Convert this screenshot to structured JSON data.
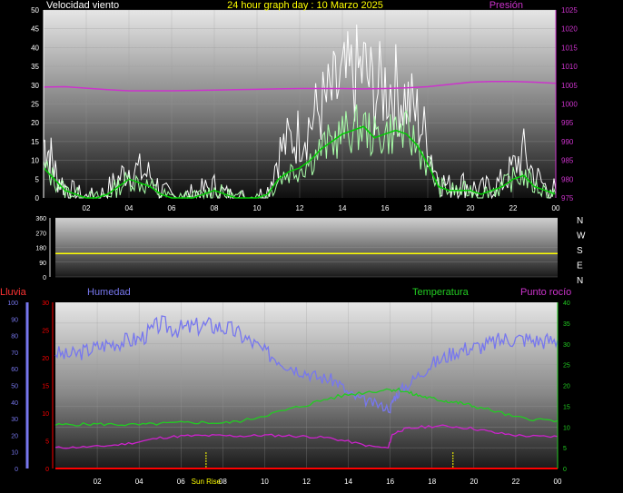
{
  "title": "24 hour graph day : 10 Marzo 2025",
  "colors": {
    "background": "#000000",
    "wind": "#ffffff",
    "gust": "#e8e8e8",
    "wind_avg": "#00cc00",
    "wind_light": "#aaffaa",
    "pressure": "#cc33cc",
    "direction": "#ffff00",
    "humidity": "#7777ee",
    "temperature": "#22cc22",
    "dewpoint": "#cc22cc",
    "rain": "#ff0000",
    "sun": "#ffff00",
    "axis_text": "#ffffff"
  },
  "x_tick_labels": [
    "02",
    "04",
    "06",
    "08",
    "10",
    "12",
    "14",
    "16",
    "18",
    "20",
    "22",
    "00"
  ],
  "chart_data": [
    {
      "type": "line",
      "name": "wind-pressure",
      "title": "",
      "left_label": "Velocidad viento",
      "right_label": "Presión",
      "ylim_left": [
        0,
        50
      ],
      "ylim_right": [
        975,
        1025
      ],
      "left_ticks": [
        "0",
        "5",
        "10",
        "15",
        "20",
        "25",
        "30",
        "35",
        "40",
        "45",
        "50"
      ],
      "right_ticks": [
        "975",
        "980",
        "985",
        "990",
        "995",
        "1000",
        "1005",
        "1010",
        "1015",
        "1020",
        "1025"
      ],
      "xlim": [
        0,
        24
      ],
      "series": [
        {
          "axis": "left",
          "x": [
            0,
            0.3,
            0.6,
            1,
            1.5,
            2,
            2.5,
            3,
            3.5,
            4,
            4.5,
            5,
            5.5,
            6,
            6.5,
            7,
            7.5,
            8,
            8.5,
            9,
            9.5,
            10,
            10.5,
            11,
            11.5,
            12,
            12.5,
            13,
            13.5,
            14,
            14.5,
            15,
            15.5,
            16,
            16.5,
            17,
            17.5,
            18,
            18.5,
            19,
            19.5,
            20,
            20.5,
            21,
            21.5,
            22,
            22.5,
            23,
            23.5,
            24
          ],
          "values": [
            15,
            12,
            6,
            3,
            1,
            0,
            0,
            2,
            5,
            8,
            7,
            6,
            2,
            0,
            0,
            1,
            2,
            3,
            1,
            0,
            0,
            0,
            2,
            12,
            15,
            17,
            20,
            24,
            27,
            30,
            32,
            34,
            28,
            30,
            29,
            26,
            22,
            15,
            5,
            3,
            4,
            3,
            2,
            3,
            4,
            8,
            12,
            6,
            3,
            2
          ]
        },
        {
          "axis": "left",
          "x": [
            0,
            0.5,
            1,
            1.5,
            2,
            2.5,
            3,
            3.5,
            4,
            4.5,
            5,
            5.5,
            6,
            6.5,
            7,
            7.5,
            8,
            8.5,
            9,
            9.5,
            10,
            10.5,
            11,
            11.5,
            12,
            12.5,
            13,
            13.5,
            14,
            14.5,
            15,
            15.5,
            16,
            16.5,
            17,
            17.5,
            18,
            18.5,
            19,
            19.5,
            20,
            20.5,
            21,
            21.5,
            22,
            22.5,
            23,
            23.5,
            24
          ],
          "values": [
            8,
            5,
            2,
            1,
            0,
            0,
            1,
            3,
            5,
            4,
            3,
            1,
            0,
            0,
            0,
            1,
            2,
            1,
            0,
            0,
            0,
            1,
            5,
            7,
            8,
            10,
            13,
            15,
            17,
            18,
            19,
            16,
            17,
            18,
            17,
            14,
            9,
            3,
            2,
            2,
            2,
            1,
            2,
            3,
            5,
            6,
            3,
            2,
            1
          ]
        },
        {
          "axis": "right",
          "x": [
            0,
            1,
            2,
            3,
            4,
            5,
            6,
            7,
            8,
            9,
            10,
            11,
            12,
            13,
            14,
            15,
            16,
            17,
            18,
            19,
            20,
            21,
            22,
            23,
            24
          ],
          "values": [
            1004.5,
            1004.6,
            1004.2,
            1003.8,
            1003.5,
            1003.5,
            1003.5,
            1003.6,
            1003.7,
            1003.8,
            1003.9,
            1004.0,
            1004.1,
            1004.1,
            1004.1,
            1004.0,
            1004.1,
            1004.3,
            1004.6,
            1005.2,
            1005.8,
            1006.0,
            1006.0,
            1005.8,
            1005.5
          ]
        }
      ]
    },
    {
      "type": "line",
      "name": "wind-direction",
      "title": "",
      "ylim": [
        0,
        360
      ],
      "left_ticks": [
        "0",
        "90",
        "180",
        "270",
        "360"
      ],
      "right_ticks": [
        "N",
        "W",
        "S",
        "E",
        "N"
      ],
      "series": [
        {
          "x": [
            0,
            24
          ],
          "values": [
            143,
            143
          ]
        }
      ]
    },
    {
      "type": "line",
      "name": "humidity-temperature",
      "title": "",
      "labels": {
        "rain": "Lluvia",
        "humidity": "Humedad",
        "temperature": "Temperatura",
        "dewpoint": "Punto rocío"
      },
      "rain_ticks": [
        "0",
        "5",
        "10",
        "15",
        "20",
        "25",
        "30"
      ],
      "humidity_ticks": [
        "0",
        "10",
        "20",
        "30",
        "40",
        "50",
        "60",
        "70",
        "80",
        "90",
        "100"
      ],
      "temp_ticks": [
        "0",
        "5",
        "10",
        "15",
        "20",
        "25",
        "30",
        "35",
        "40"
      ],
      "ylim_humidity": [
        0,
        100
      ],
      "ylim_temp": [
        0,
        40
      ],
      "ylim_rain": [
        0,
        30
      ],
      "sun_label": "Sun Rise",
      "sun_events": [
        7.2,
        19.0
      ],
      "series": [
        {
          "axis": "humidity",
          "x": [
            0,
            0.5,
            1,
            1.5,
            2,
            2.5,
            3,
            3.5,
            4,
            4.5,
            5,
            5.5,
            6,
            6.5,
            7,
            7.5,
            8,
            8.5,
            9,
            9.5,
            10,
            10.5,
            11,
            11.5,
            12,
            12.5,
            13,
            13.5,
            14,
            14.5,
            15,
            15.5,
            16,
            16.2,
            16.5,
            17,
            17.5,
            18,
            18.5,
            19,
            19.5,
            20,
            20.5,
            21,
            21.5,
            22,
            22.5,
            23,
            23.5,
            24
          ],
          "values": [
            70,
            68,
            69,
            71,
            73,
            75,
            76,
            77,
            78,
            82,
            87,
            85,
            84,
            85,
            86,
            86,
            85,
            83,
            79,
            75,
            70,
            67,
            63,
            60,
            58,
            55,
            54,
            52,
            45,
            42,
            40,
            38,
            36,
            43,
            47,
            52,
            58,
            63,
            66,
            70,
            72,
            73,
            74,
            76,
            78,
            78,
            78,
            77,
            77,
            77
          ]
        },
        {
          "axis": "temp",
          "x": [
            0,
            1,
            2,
            3,
            4,
            5,
            6,
            7,
            8,
            9,
            10,
            11,
            12,
            13,
            14,
            15,
            16,
            16.5,
            17,
            17.5,
            18,
            18.5,
            19,
            19.5,
            20,
            21,
            22,
            23,
            24
          ],
          "values": [
            10.5,
            10.6,
            10.7,
            10.6,
            10.5,
            10.8,
            11.0,
            11.1,
            10.9,
            11.5,
            12.8,
            14.0,
            15.3,
            16.8,
            17.8,
            18.5,
            19.1,
            18.9,
            18.0,
            17.4,
            16.8,
            16.4,
            16.0,
            15.6,
            15.0,
            13.8,
            12.3,
            11.8,
            11.5
          ]
        },
        {
          "axis": "temp",
          "x": [
            0,
            1,
            2,
            3,
            4,
            5,
            6,
            7,
            8,
            9,
            10,
            11,
            12,
            13,
            14,
            15,
            15.9,
            16.1,
            16.5,
            17,
            18,
            19,
            20,
            21,
            22,
            23,
            24
          ],
          "values": [
            5.0,
            5.1,
            5.3,
            5.7,
            6.4,
            7.4,
            7.8,
            7.9,
            7.9,
            7.8,
            8.0,
            7.9,
            7.7,
            7.4,
            6.5,
            5.4,
            4.9,
            8.2,
            9.2,
            9.7,
            10.2,
            10.1,
            9.6,
            8.6,
            8.0,
            7.7,
            7.7
          ]
        },
        {
          "axis": "rain",
          "x": [
            0,
            24
          ],
          "values": [
            0,
            0
          ]
        }
      ]
    }
  ]
}
